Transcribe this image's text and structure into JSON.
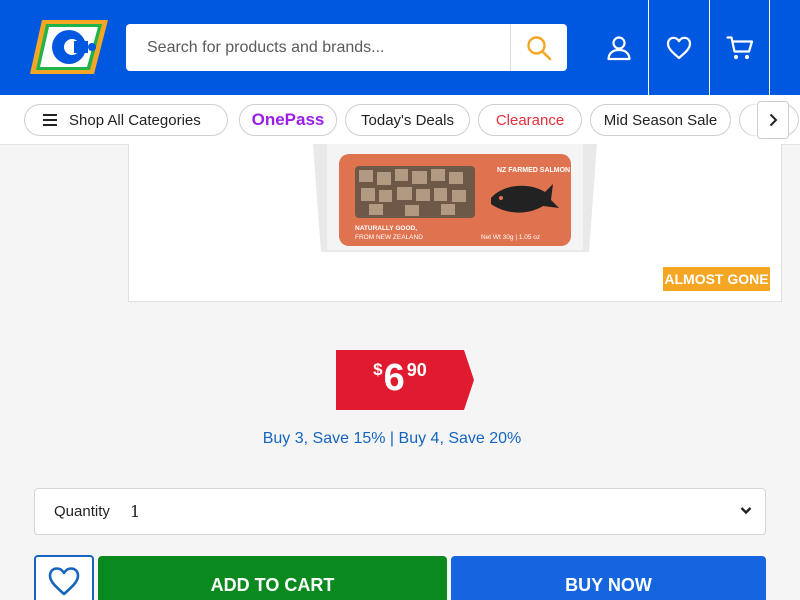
{
  "header": {
    "logo_alt": "C",
    "search": {
      "placeholder": "Search for products and brands..."
    },
    "colors": {
      "brand": "#0057e0",
      "search_icon": "#f5a623"
    },
    "icons": [
      "user-icon",
      "heart-icon",
      "cart-icon",
      "search-icon"
    ]
  },
  "nav": {
    "items": [
      {
        "label": "Shop All Categories",
        "icon": "menu-icon"
      },
      {
        "label": "OnePass"
      },
      {
        "label": "Today's Deals"
      },
      {
        "label": "Clearance"
      },
      {
        "label": "Mid Season Sale"
      },
      {
        "label": ""
      }
    ],
    "next_icon": "chevron-right-icon"
  },
  "product": {
    "pack": {
      "flavour": "NZ FARMED SALMON",
      "tagline_1": "NATURALLY GOOD,",
      "tagline_2": "FROM NEW ZEALAND",
      "weight": "Net Wt 30g | 1.05 oz"
    },
    "badge": "ALMOST GONE",
    "price": {
      "symbol": "$",
      "dollars": "6",
      "cents": "90"
    },
    "promo": "Buy 3, Save 15% | Buy 4, Save 20%"
  },
  "quantity": {
    "label": "Quantity",
    "value": "1"
  },
  "actions": {
    "add_to_cart": "ADD TO CART",
    "buy_now": "BUY NOW",
    "colors": {
      "add": "#0a8a1e",
      "buy": "#1565e0",
      "price": "#e01b2f",
      "badge": "#f5a623"
    }
  }
}
